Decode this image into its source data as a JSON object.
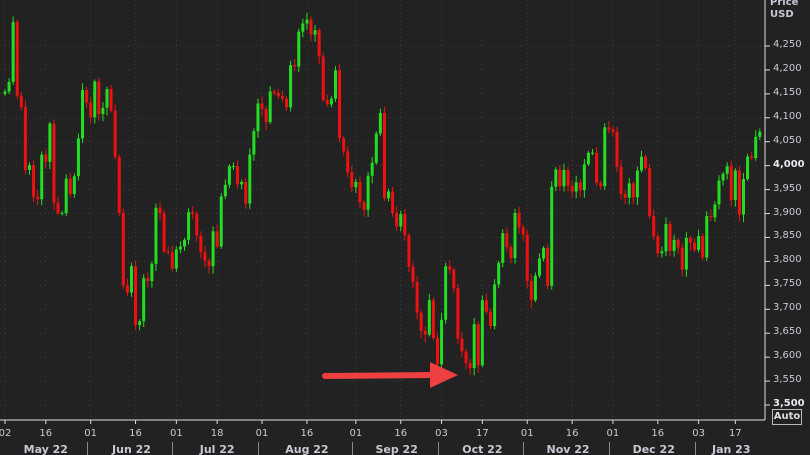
{
  "chart_data": {
    "type": "candlestick",
    "title": "",
    "ylabel": "Price USD",
    "ylim": [
      3500,
      4250
    ],
    "yticks": [
      "4,250",
      "4,200",
      "4,150",
      "4,100",
      "4,050",
      "4,000",
      "3,950",
      "3,900",
      "3,850",
      "3,800",
      "3,750",
      "3,700",
      "3,650",
      "3,600",
      "3,550",
      "3,500"
    ],
    "bold_yticks": [
      "4,000",
      "3,500"
    ],
    "colors": {
      "up": "#22dd22",
      "down": "#ee1111",
      "arrow": "#ee4040"
    },
    "day_ticks": [
      {
        "label": "02",
        "i": 0
      },
      {
        "label": "16",
        "i": 10
      },
      {
        "label": "01",
        "i": 21
      },
      {
        "label": "16",
        "i": 32
      },
      {
        "label": "01",
        "i": 42
      },
      {
        "label": "18",
        "i": 52
      },
      {
        "label": "01",
        "i": 63
      },
      {
        "label": "16",
        "i": 74
      },
      {
        "label": "01",
        "i": 86
      },
      {
        "label": "16",
        "i": 97
      },
      {
        "label": "03",
        "i": 107
      },
      {
        "label": "17",
        "i": 117
      },
      {
        "label": "01",
        "i": 128
      },
      {
        "label": "16",
        "i": 139
      },
      {
        "label": "01",
        "i": 149
      },
      {
        "label": "16",
        "i": 160
      },
      {
        "label": "03",
        "i": 170
      },
      {
        "label": "17",
        "i": 179
      }
    ],
    "months": [
      {
        "label": "May 22",
        "i": 10
      },
      {
        "label": "Jun 22",
        "i": 31
      },
      {
        "label": "Jul 22",
        "i": 52
      },
      {
        "label": "Aug 22",
        "i": 74
      },
      {
        "label": "Sep 22",
        "i": 96
      },
      {
        "label": "Oct 22",
        "i": 117
      },
      {
        "label": "Nov 22",
        "i": 138
      },
      {
        "label": "Dec 22",
        "i": 159
      },
      {
        "label": "Jan 23",
        "i": 178
      }
    ],
    "month_starts": [
      21,
      42,
      63,
      86,
      107,
      128,
      149,
      170
    ],
    "first_open": 4150,
    "close": [
      4155,
      4175,
      4300,
      4146,
      4123,
      3991,
      4001,
      3935,
      3930,
      4023,
      4008,
      4088,
      3923,
      3901,
      3901,
      3973,
      3941,
      3978,
      4057,
      4158,
      4132,
      4101,
      4176,
      4108,
      4121,
      4160,
      4115,
      4018,
      3901,
      3750,
      3735,
      3790,
      3667,
      3675,
      3765,
      3759,
      3795,
      3912,
      3901,
      3821,
      3819,
      3785,
      3825,
      3831,
      3845,
      3903,
      3899,
      3854,
      3819,
      3801,
      3790,
      3863,
      3831,
      3936,
      3960,
      3999,
      3999,
      3961,
      3966,
      3921,
      4023,
      4072,
      4130,
      4118,
      4091,
      4155,
      4152,
      4145,
      4140,
      4122,
      4210,
      4207,
      4280,
      4297,
      4305,
      4274,
      4283,
      4228,
      4137,
      4128,
      4140,
      4199,
      4057,
      4030,
      3986,
      3955,
      3966,
      3924,
      3908,
      3979,
      4006,
      4067,
      4110,
      3932,
      3946,
      3901,
      3873,
      3899,
      3855,
      3789,
      3757,
      3693,
      3655,
      3647,
      3719,
      3640,
      3585,
      3678,
      3790,
      3783,
      3744,
      3639,
      3612,
      3588,
      3577,
      3669,
      3583,
      3719,
      3695,
      3665,
      3752,
      3797,
      3859,
      3830,
      3807,
      3901,
      3871,
      3856,
      3759,
      3719,
      3770,
      3806,
      3828,
      3749,
      3956,
      3992,
      3957,
      3991,
      3958,
      3946,
      3965,
      3949,
      4003,
      4027,
      4027,
      3964,
      3957,
      4080,
      4076,
      4071,
      3998,
      3941,
      3933,
      3963,
      3934,
      3990,
      4019,
      3995,
      3895,
      3852,
      3817,
      3821,
      3878,
      3822,
      3845,
      3829,
      3783,
      3849,
      3839,
      3824,
      3853,
      3808,
      3895,
      3892,
      3919,
      3969,
      3983,
      3999,
      3928,
      3990,
      3898,
      3972,
      4019,
      4016,
      4060,
      4071
    ],
    "annotation": {
      "type": "arrow",
      "points_to": "October 2022 low near 3,491"
    }
  },
  "header": {
    "price": "Price",
    "currency": "USD"
  },
  "auto_label": "Auto"
}
